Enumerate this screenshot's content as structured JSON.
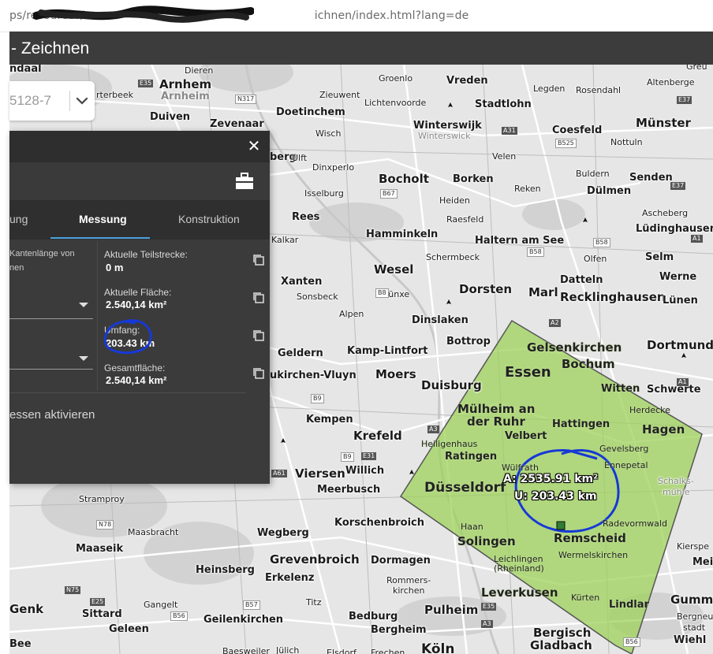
{
  "browser": {
    "url_visible": "ps/resources/",
    "url_tail": "ichnen/index.html?lang=de"
  },
  "app": {
    "title": "- Zeichnen"
  },
  "coordinate_box": {
    "value": "5128-7"
  },
  "panel": {
    "tabs": [
      {
        "label": "ung"
      },
      {
        "label": "Messung"
      },
      {
        "label": "Konstruktion"
      }
    ],
    "left_note_line1": "Kantenlänge von",
    "left_note_line2": "nen",
    "metrics": [
      {
        "label": "Aktuelle Teilstrecke:",
        "value": "0 m"
      },
      {
        "label": "Aktuelle Fläche:",
        "value": "2.540,14 km²"
      },
      {
        "label": "Umfang:",
        "value": "203.43 km"
      },
      {
        "label": "Gesamtfläche:",
        "value": "2.540,14 km²"
      }
    ],
    "activate_text": "essen aktivieren"
  },
  "measurement": {
    "area": "A: 2535.91 km²",
    "perimeter": "U: 203.43 km"
  },
  "places": [
    {
      "name": "ndaal",
      "cls": "mid"
    },
    {
      "name": "Dieren",
      "cls": "sm"
    },
    {
      "name": "Arnhem",
      "cls": "big"
    },
    {
      "name": "Arnheim",
      "cls": "mid grey"
    },
    {
      "name": "rterbeek",
      "cls": "sm"
    },
    {
      "name": "Duiven",
      "cls": "mid"
    },
    {
      "name": "Zevenaar",
      "cls": "mid"
    },
    {
      "name": "Groenlo",
      "cls": "sm"
    },
    {
      "name": "Vreden",
      "cls": "mid"
    },
    {
      "name": "Legden",
      "cls": "sm"
    },
    {
      "name": "Rosendahl",
      "cls": "sm"
    },
    {
      "name": "Altenberge",
      "cls": "sm"
    },
    {
      "name": "Zieuwent",
      "cls": "sm"
    },
    {
      "name": "Lichtenvoorde",
      "cls": "sm"
    },
    {
      "name": "Stadtlohn",
      "cls": "mid"
    },
    {
      "name": "Doetinchem",
      "cls": "mid"
    },
    {
      "name": "Münster",
      "cls": "big"
    },
    {
      "name": "Winterswijk",
      "cls": "mid"
    },
    {
      "name": "Winterswick",
      "cls": "sm grey"
    },
    {
      "name": "Coesfeld",
      "cls": "mid"
    },
    {
      "name": "Wisch",
      "cls": "sm"
    },
    {
      "name": "Nottuln",
      "cls": "sm"
    },
    {
      "name": "Velen",
      "cls": "sm"
    },
    {
      "name": "berg",
      "cls": "mid"
    },
    {
      "name": "Ulft",
      "cls": "sm"
    },
    {
      "name": "Dinxperlo",
      "cls": "sm"
    },
    {
      "name": "Bocholt",
      "cls": "big"
    },
    {
      "name": "Borken",
      "cls": "mid"
    },
    {
      "name": "Buldern",
      "cls": "sm"
    },
    {
      "name": "Senden",
      "cls": "mid"
    },
    {
      "name": "Isselburg",
      "cls": "sm"
    },
    {
      "name": "Heiden",
      "cls": "sm"
    },
    {
      "name": "Reken",
      "cls": "sm"
    },
    {
      "name": "Dülmen",
      "cls": "mid"
    },
    {
      "name": "Rees",
      "cls": "mid"
    },
    {
      "name": "Raesfeld",
      "cls": "sm"
    },
    {
      "name": "Ascheberg",
      "cls": "sm"
    },
    {
      "name": "Hamminkeln",
      "cls": "mid"
    },
    {
      "name": "Lüdinghausen",
      "cls": "mid"
    },
    {
      "name": "Kalkar",
      "cls": "sm"
    },
    {
      "name": "Haltern am See",
      "cls": "mid"
    },
    {
      "name": "Schermbeck",
      "cls": "sm"
    },
    {
      "name": "Olfen",
      "cls": "sm"
    },
    {
      "name": "Selm",
      "cls": "mid"
    },
    {
      "name": "Wesel",
      "cls": "big"
    },
    {
      "name": "Xanten",
      "cls": "mid"
    },
    {
      "name": "Datteln",
      "cls": "mid"
    },
    {
      "name": "Werne",
      "cls": "mid"
    },
    {
      "name": "Sonsbeck",
      "cls": "sm"
    },
    {
      "name": "Hünxe",
      "cls": "sm"
    },
    {
      "name": "Dorsten",
      "cls": "big"
    },
    {
      "name": "Marl",
      "cls": "big"
    },
    {
      "name": "Recklinghausen",
      "cls": "big"
    },
    {
      "name": "Lünen",
      "cls": "mid"
    },
    {
      "name": "Alpen",
      "cls": "sm"
    },
    {
      "name": "Dinslaken",
      "cls": "mid"
    },
    {
      "name": "Bottrop",
      "cls": "mid"
    },
    {
      "name": "Gelsenkirchen",
      "cls": "big"
    },
    {
      "name": "Dortmund",
      "cls": "big"
    },
    {
      "name": "Geldern",
      "cls": "mid"
    },
    {
      "name": "Kamp-Lintfort",
      "cls": "mid"
    },
    {
      "name": "Bochum",
      "cls": "big"
    },
    {
      "name": "Essen",
      "cls": "big"
    },
    {
      "name": "ukirchen-Vluyn",
      "cls": "mid"
    },
    {
      "name": "Moers",
      "cls": "big"
    },
    {
      "name": "Duisburg",
      "cls": "big"
    },
    {
      "name": "Witten",
      "cls": "mid"
    },
    {
      "name": "Schwerte",
      "cls": "mid"
    },
    {
      "name": "Mülheim an",
      "cls": "big"
    },
    {
      "name": "der Ruhr",
      "cls": "big"
    },
    {
      "name": "Herdecke",
      "cls": "sm"
    },
    {
      "name": "Kempen",
      "cls": "mid"
    },
    {
      "name": "Krefeld",
      "cls": "big"
    },
    {
      "name": "Velbert",
      "cls": "mid"
    },
    {
      "name": "Hattingen",
      "cls": "mid"
    },
    {
      "name": "Hagen",
      "cls": "big"
    },
    {
      "name": "Heiligenhaus",
      "cls": "sm"
    },
    {
      "name": "Ratingen",
      "cls": "mid"
    },
    {
      "name": "Gevelsberg",
      "cls": "sm"
    },
    {
      "name": "Viersen",
      "cls": "big"
    },
    {
      "name": "Willich",
      "cls": "mid"
    },
    {
      "name": "Wülfrath",
      "cls": "sm"
    },
    {
      "name": "Ennepetal",
      "cls": "sm"
    },
    {
      "name": "Meerbusch",
      "cls": "mid"
    },
    {
      "name": "Düsseldorf",
      "cls": "big"
    },
    {
      "name": "Schalks-",
      "cls": "sm grey"
    },
    {
      "name": "mühle",
      "cls": "sm grey"
    },
    {
      "name": "Stramproy",
      "cls": "sm"
    },
    {
      "name": "Korschenbroich",
      "cls": "mid"
    },
    {
      "name": "Radevormwald",
      "cls": "sm"
    },
    {
      "name": "Haan",
      "cls": "sm"
    },
    {
      "name": "Remscheid",
      "cls": "big"
    },
    {
      "name": "Wegberg",
      "cls": "mid"
    },
    {
      "name": "Maasbracht",
      "cls": "sm"
    },
    {
      "name": "Solingen",
      "cls": "big"
    },
    {
      "name": "Kierspe",
      "cls": "sm"
    },
    {
      "name": "Maaseik",
      "cls": "mid"
    },
    {
      "name": "Grevenbroich",
      "cls": "big"
    },
    {
      "name": "Dormagen",
      "cls": "mid"
    },
    {
      "name": "Leichlingen",
      "cls": "sm"
    },
    {
      "name": "(Rheinland)",
      "cls": "sm"
    },
    {
      "name": "Wermelskirchen",
      "cls": "sm"
    },
    {
      "name": "Mein",
      "cls": "mid"
    },
    {
      "name": "Heinsberg",
      "cls": "mid"
    },
    {
      "name": "Erkelenz",
      "cls": "mid"
    },
    {
      "name": "Rommers-",
      "cls": "sm"
    },
    {
      "name": "kirchen",
      "cls": "sm"
    },
    {
      "name": "Leverkusen",
      "cls": "big"
    },
    {
      "name": "Kürten",
      "cls": "sm"
    },
    {
      "name": "Lindlar",
      "cls": "mid"
    },
    {
      "name": "Gumme",
      "cls": "big"
    },
    {
      "name": "Genk",
      "cls": "big"
    },
    {
      "name": "Gangelt",
      "cls": "sm"
    },
    {
      "name": "Titz",
      "cls": "sm"
    },
    {
      "name": "Pulheim",
      "cls": "big"
    },
    {
      "name": "Bergneu-",
      "cls": "sm"
    },
    {
      "name": "stadt",
      "cls": "sm"
    },
    {
      "name": "Sittard",
      "cls": "mid"
    },
    {
      "name": "Geilenkirchen",
      "cls": "mid"
    },
    {
      "name": "Bedburg",
      "cls": "mid"
    },
    {
      "name": "Bergisch",
      "cls": "big"
    },
    {
      "name": "Geleen",
      "cls": "mid"
    },
    {
      "name": "Bergheim",
      "cls": "mid"
    },
    {
      "name": "Gladbach",
      "cls": "big"
    },
    {
      "name": "Wiehl",
      "cls": "mid"
    },
    {
      "name": "Jülich",
      "cls": "sm"
    },
    {
      "name": "Baesweiler",
      "cls": "sm"
    },
    {
      "name": "Köln",
      "cls": "big"
    },
    {
      "name": "Elsdorf",
      "cls": "sm"
    },
    {
      "name": "Frechen",
      "cls": "sm"
    },
    {
      "name": "Bee",
      "cls": "mid"
    },
    {
      "name": "Greu",
      "cls": "sm"
    }
  ]
}
